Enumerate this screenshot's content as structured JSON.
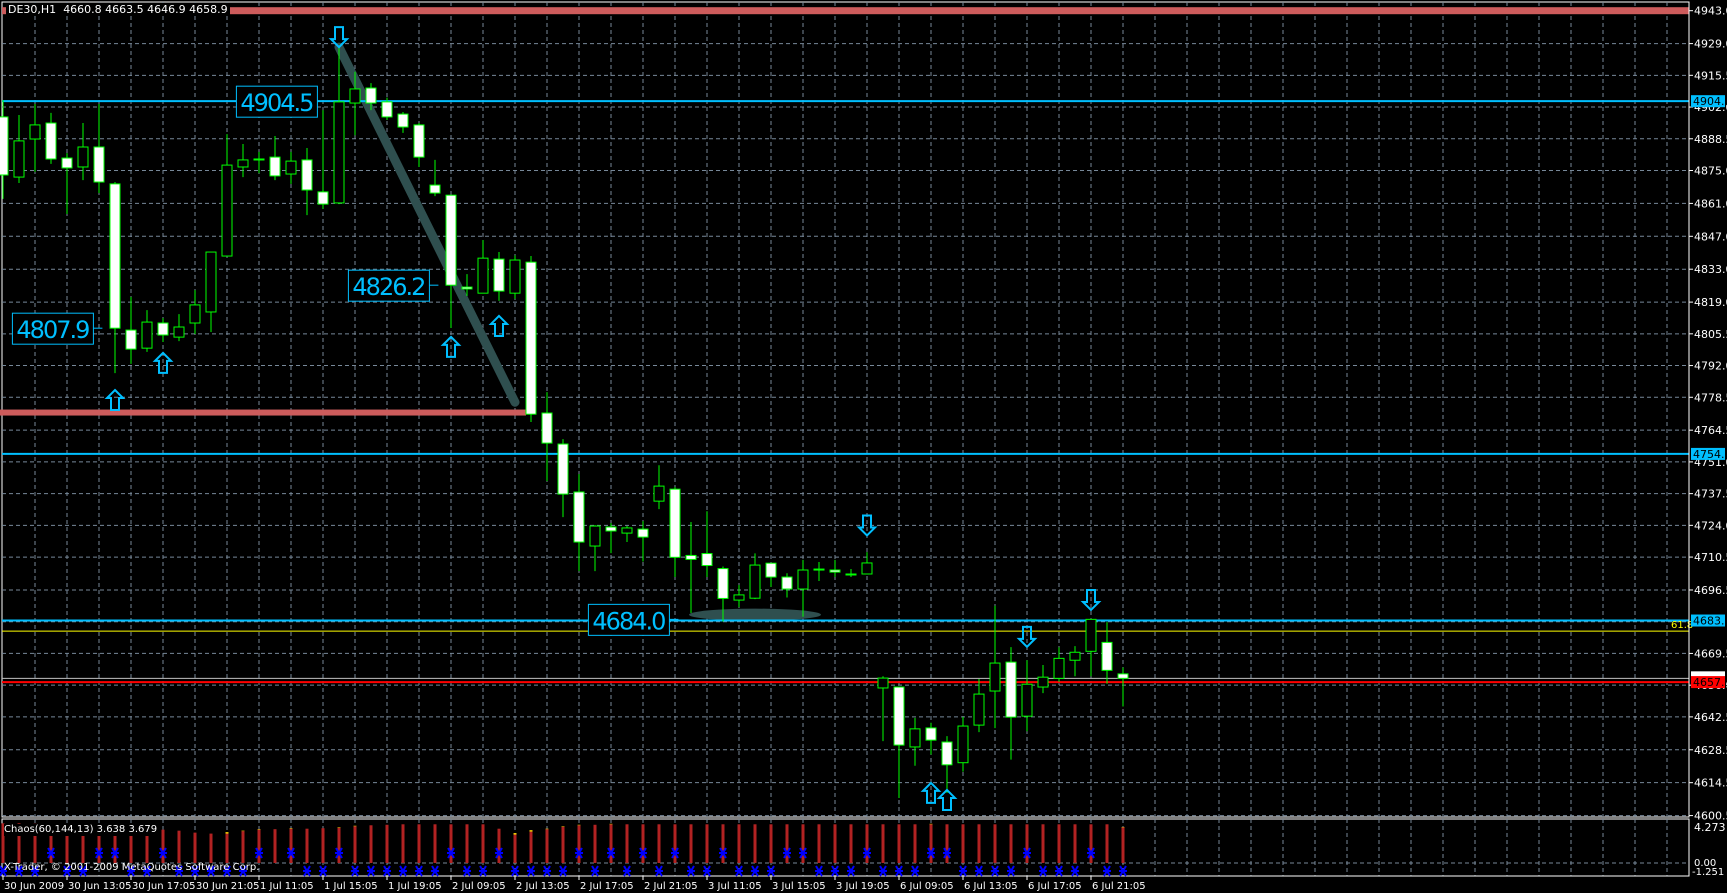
{
  "header": {
    "symbol": "DE30,H1",
    "ohlc": "4660.8 4663.5 4646.9 4658.9"
  },
  "colors": {
    "background": "#000000",
    "grid": "#778899",
    "axis": "#ffffff",
    "bull_outline": "#00ff00",
    "bear_fill": "#ffffff",
    "bull_fill": "#000000",
    "level_cyan": "#00bfff",
    "resistance_salmon": "#cd5c5c",
    "fib_yellow": "#ffff00",
    "bid_red": "#ff0000",
    "ask_grey": "#c0c0c0",
    "trend_teal": "#2f4f4f",
    "histogram_red": "#b22222",
    "histogram_yellow": "#ffd700",
    "signal_blue": "#0000ff"
  },
  "chart_data": {
    "type": "candlestick",
    "symbol": "DE30",
    "timeframe": "H1",
    "ylim": [
      4600.5,
      4943.0
    ],
    "grid": true,
    "price_ticks": [
      "4943.0",
      "4929.0",
      "4915.5",
      "4902.0",
      "4888.5",
      "4875.0",
      "4861.0",
      "4847.0",
      "4833.0",
      "4819.0",
      "4805.5",
      "4792.0",
      "4778.5",
      "4764.5",
      "4751.0",
      "4737.5",
      "4724.0",
      "4710.5",
      "4696.5",
      "4669.5",
      "4656.0",
      "4642.5",
      "4628.5",
      "4614.5",
      "4600.5"
    ],
    "time_ticks": [
      {
        "bar": 0,
        "label": "30 Jun 2009"
      },
      {
        "bar": 4,
        "label": "30 Jun 13:05"
      },
      {
        "bar": 8,
        "label": "30 Jun 17:05"
      },
      {
        "bar": 12,
        "label": "30 Jun 21:05"
      },
      {
        "bar": 16,
        "label": "1 Jul 11:05"
      },
      {
        "bar": 20,
        "label": "1 Jul 15:05"
      },
      {
        "bar": 24,
        "label": "1 Jul 19:05"
      },
      {
        "bar": 28,
        "label": "2 Jul 09:05"
      },
      {
        "bar": 32,
        "label": "2 Jul 13:05"
      },
      {
        "bar": 36,
        "label": "2 Jul 17:05"
      },
      {
        "bar": 40,
        "label": "2 Jul 21:05"
      },
      {
        "bar": 44,
        "label": "3 Jul 11:05"
      },
      {
        "bar": 48,
        "label": "3 Jul 15:05"
      },
      {
        "bar": 52,
        "label": "3 Jul 19:05"
      },
      {
        "bar": 56,
        "label": "6 Jul 09:05"
      },
      {
        "bar": 60,
        "label": "6 Jul 13:05"
      },
      {
        "bar": 64,
        "label": "6 Jul 17:05"
      },
      {
        "bar": 68,
        "label": "6 Jul 21:05"
      }
    ],
    "ohlc": [
      [
        4897.8,
        4905.0,
        4862.9,
        4873.1
      ],
      [
        4872.2,
        4898.6,
        4869.7,
        4887.6
      ],
      [
        4888.4,
        4903.3,
        4874.4,
        4894.4
      ],
      [
        4895.2,
        4899.5,
        4877.8,
        4879.9
      ],
      [
        4880.3,
        4882.4,
        4856.5,
        4876.1
      ],
      [
        4876.5,
        4895.2,
        4870.9,
        4885.0
      ],
      [
        4885.0,
        4903.3,
        4865.4,
        4870.1
      ],
      [
        4869.3,
        4870.1,
        4788.8,
        4807.9
      ],
      [
        4807.1,
        4821.2,
        4792.7,
        4799.0
      ],
      [
        4799.4,
        4815.6,
        4797.8,
        4810.5
      ],
      [
        4810.1,
        4812.2,
        4802.0,
        4805.0
      ],
      [
        4804.1,
        4813.9,
        4802.4,
        4808.4
      ],
      [
        4810.1,
        4824.1,
        4805.4,
        4817.8
      ],
      [
        4814.8,
        4840.3,
        4806.3,
        4840.3
      ],
      [
        4838.6,
        4890.5,
        4838.6,
        4877.3
      ],
      [
        4876.5,
        4886.3,
        4872.2,
        4879.5
      ],
      [
        4879.9,
        4882.9,
        4873.9,
        4879.9
      ],
      [
        4880.7,
        4889.7,
        4870.9,
        4872.7
      ],
      [
        4873.5,
        4882.9,
        4869.3,
        4879.0
      ],
      [
        4879.5,
        4884.6,
        4856.0,
        4866.7
      ],
      [
        4865.9,
        4900.7,
        4858.6,
        4860.7
      ],
      [
        4861.2,
        4927.5,
        4860.7,
        4904.2
      ],
      [
        4903.7,
        4917.0,
        4890.0,
        4909.7
      ],
      [
        4910.1,
        4912.2,
        4900.7,
        4903.7
      ],
      [
        4904.2,
        4906.0,
        4896.5,
        4897.8
      ],
      [
        4899.0,
        4899.9,
        4891.0,
        4893.5
      ],
      [
        4894.4,
        4895.2,
        4876.5,
        4880.7
      ],
      [
        4868.8,
        4879.5,
        4864.1,
        4865.4
      ],
      [
        4864.5,
        4864.5,
        4808.0,
        4826.2
      ],
      [
        4825.4,
        4830.9,
        4821.6,
        4824.6
      ],
      [
        4822.8,
        4845.4,
        4822.8,
        4837.7
      ],
      [
        4837.3,
        4840.3,
        4819.5,
        4823.7
      ],
      [
        4822.8,
        4838.9,
        4820.4,
        4836.9
      ],
      [
        4836.0,
        4838.6,
        4768.0,
        4771.3
      ],
      [
        4771.8,
        4780.7,
        4742.8,
        4759.0
      ],
      [
        4758.6,
        4760.7,
        4727.5,
        4737.3
      ],
      [
        4738.2,
        4745.8,
        4704.5,
        4716.9
      ],
      [
        4715.2,
        4724.1,
        4704.5,
        4723.7
      ],
      [
        4723.3,
        4725.0,
        4712.2,
        4721.6
      ],
      [
        4720.7,
        4723.7,
        4716.9,
        4722.9
      ],
      [
        4722.4,
        4725.8,
        4708.6,
        4719.0
      ],
      [
        4734.3,
        4749.6,
        4730.9,
        4740.7
      ],
      [
        4739.4,
        4740.3,
        4702.0,
        4710.4
      ],
      [
        4711.2,
        4725.4,
        4686.7,
        4709.5
      ],
      [
        4712.0,
        4730.0,
        4702.0,
        4706.9
      ],
      [
        4705.6,
        4706.5,
        4683.1,
        4692.9
      ],
      [
        4692.2,
        4698.6,
        4689.2,
        4694.4
      ],
      [
        4693.0,
        4712.1,
        4692.6,
        4707.1
      ],
      [
        4707.9,
        4707.9,
        4697.8,
        4702.0
      ],
      [
        4702.0,
        4703.6,
        4693.3,
        4696.9
      ],
      [
        4696.9,
        4709.3,
        4685.1,
        4705.0
      ],
      [
        4705.4,
        4708.4,
        4700.3,
        4705.4
      ],
      [
        4705.0,
        4709.3,
        4702.0,
        4704.1
      ],
      [
        4703.3,
        4705.4,
        4702.0,
        4703.3
      ],
      [
        4703.3,
        4712.6,
        4703.3,
        4708.0
      ],
      [
        4654.8,
        4659.8,
        4632.2,
        4659.0
      ],
      [
        4655.2,
        4655.2,
        4608.0,
        4630.5
      ],
      [
        4629.7,
        4642.1,
        4621.7,
        4637.4
      ],
      [
        4637.8,
        4640.0,
        4626.5,
        4632.6
      ],
      [
        4631.8,
        4634.3,
        4610.1,
        4622.1
      ],
      [
        4623.0,
        4642.5,
        4619.2,
        4638.6
      ],
      [
        4639.0,
        4658.6,
        4636.0,
        4652.2
      ],
      [
        4653.5,
        4689.8,
        4637.7,
        4665.4
      ],
      [
        4665.8,
        4672.2,
        4624.3,
        4642.4
      ],
      [
        4642.8,
        4666.6,
        4636.4,
        4656.4
      ],
      [
        4655.2,
        4664.6,
        4652.6,
        4659.4
      ],
      [
        4658.9,
        4672.1,
        4657.4,
        4667.4
      ],
      [
        4666.6,
        4672.6,
        4659.8,
        4670.0
      ],
      [
        4670.4,
        4684.0,
        4659.8,
        4684.0
      ],
      [
        4674.2,
        4682.8,
        4656.6,
        4662.3
      ],
      [
        4660.8,
        4663.5,
        4646.9,
        4658.9
      ]
    ],
    "fractals_up": [
      {
        "bar": 7,
        "price": 4781.6
      },
      {
        "bar": 10,
        "price": 4797.4
      },
      {
        "bar": 28,
        "price": 4804.2
      },
      {
        "bar": 31,
        "price": 4813.1
      },
      {
        "bar": 58,
        "price": 4614.4
      },
      {
        "bar": 59,
        "price": 4611.4
      }
    ],
    "fractals_down": [
      {
        "bar": 21,
        "price": 4927.5
      },
      {
        "bar": 54,
        "price": 4719.7
      },
      {
        "bar": 64,
        "price": 4672.3
      },
      {
        "bar": 68,
        "price": 4688.0
      }
    ],
    "horizontal_levels": [
      {
        "price": 4943.0,
        "color": "resistance_salmon",
        "style": "thick"
      },
      {
        "price": 4904.5,
        "color": "level_cyan",
        "label": "4904.5"
      },
      {
        "price": 4754.4,
        "color": "level_cyan",
        "label": "4754.4"
      },
      {
        "price": 4683.5,
        "color": "level_cyan",
        "label": "4683.5"
      },
      {
        "price": 4679.0,
        "color": "fib_yellow",
        "fib_label": "61.8"
      },
      {
        "price": 4658.9,
        "color": "ask_grey"
      },
      {
        "price": 4657.3,
        "color": "bid_red",
        "label": "4657.3"
      }
    ],
    "support_segment": {
      "price": 4772.0,
      "from_bar": 0,
      "to_bar": 33
    },
    "trendline": {
      "from": {
        "bar": 21,
        "price": 4927.5
      },
      "to": {
        "bar": 32,
        "price": 4776.4
      }
    },
    "ellipse": {
      "from_bar": 43,
      "to_bar": 51,
      "price": 4686.0
    },
    "price_labels": [
      {
        "text": "4904.5",
        "bar": 14.4,
        "price": 4904.5
      },
      {
        "text": "4807.9",
        "bar": 0.4,
        "price": 4807.9
      },
      {
        "text": "4826.2",
        "bar": 21.4,
        "price": 4826.2
      },
      {
        "text": "4684.0",
        "bar": 36.4,
        "price": 4684.0
      }
    ],
    "indicator": {
      "title": "Chaos(60,144,13) 3.638 3.679",
      "axis_max": "4.273",
      "axis_zero": "0.00",
      "axis_min": "-1.251",
      "ylim": [
        -1.251,
        4.273
      ],
      "values": [
        4.05,
        4.05,
        4.0,
        3.9,
        3.85,
        3.8,
        3.75,
        3.7,
        3.65,
        3.6,
        3.4,
        3.3,
        3.1,
        3.0,
        3.0,
        3.25,
        3.4,
        3.45,
        3.5,
        3.5,
        3.55,
        3.6,
        3.75,
        3.85,
        3.9,
        3.95,
        3.95,
        3.95,
        3.95,
        3.95,
        3.95,
        3.5,
        2.9,
        3.2,
        3.45,
        3.7,
        3.85,
        3.9,
        3.95,
        3.95,
        3.95,
        3.95,
        3.95,
        3.95,
        3.95,
        3.95,
        3.95,
        3.95,
        3.95,
        3.95,
        3.95,
        3.95,
        3.95,
        3.95,
        3.95,
        3.95,
        3.95,
        3.95,
        3.95,
        3.95,
        3.95,
        3.95,
        3.95,
        3.95,
        3.95,
        3.95,
        3.95,
        3.95,
        3.95,
        3.95,
        3.638
      ],
      "yellow": {
        "14": 3.15,
        "15": 3.3,
        "16": 3.45,
        "18": 3.55,
        "21": 3.65,
        "22": 3.8,
        "32": 3.05,
        "33": 3.35,
        "34": 3.5,
        "35": 3.75,
        "36": 3.9,
        "38": 4.0,
        "58": 4.0,
        "70": 3.679
      },
      "signals_mid": [
        3,
        6,
        7,
        10,
        16,
        18,
        21,
        28,
        31,
        36,
        38,
        40,
        42,
        45,
        49,
        50,
        54,
        58,
        59,
        64,
        68
      ],
      "signals_low": [
        0,
        1,
        2,
        4,
        5,
        8,
        9,
        11,
        12,
        13,
        14,
        15,
        19,
        20,
        22,
        23,
        24,
        25,
        26,
        27,
        29,
        30,
        32,
        33,
        34,
        35,
        37,
        39,
        41,
        43,
        44,
        46,
        47,
        48,
        51,
        52,
        53,
        55,
        56,
        57,
        60,
        61,
        62,
        63,
        65,
        66,
        67,
        69,
        70
      ]
    }
  },
  "footer": {
    "copyright": "X-Trader, © 2001-2009 MetaQuotes Software Corp."
  }
}
